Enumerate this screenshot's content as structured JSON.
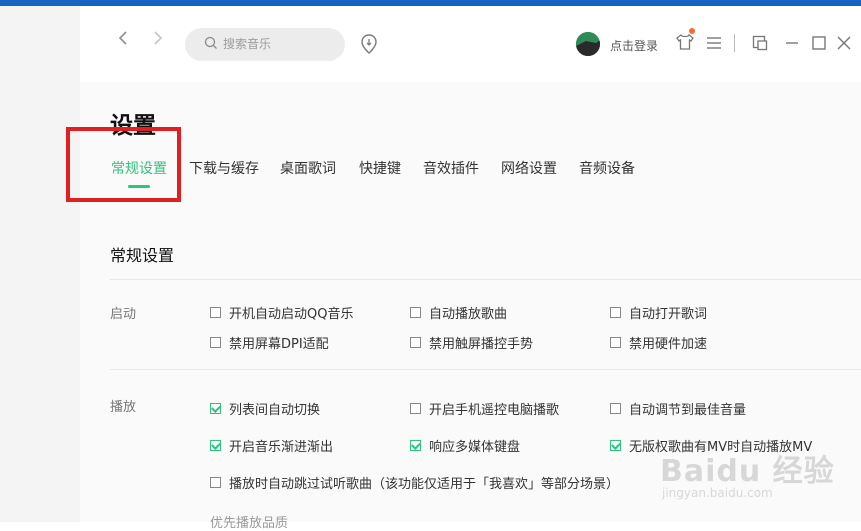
{
  "search": {
    "placeholder": "搜索音乐"
  },
  "header": {
    "login_label": "点击登录"
  },
  "page": {
    "title": "设置"
  },
  "tabs": [
    {
      "label": "常规设置",
      "active": true
    },
    {
      "label": "下载与缓存",
      "active": false
    },
    {
      "label": "桌面歌词",
      "active": false
    },
    {
      "label": "快捷键",
      "active": false
    },
    {
      "label": "音效插件",
      "active": false
    },
    {
      "label": "网络设置",
      "active": false
    },
    {
      "label": "音频设备",
      "active": false
    }
  ],
  "section": {
    "title": "常规设置"
  },
  "groups": [
    {
      "label": "启动",
      "options": [
        {
          "label": "开机自动启动QQ音乐",
          "checked": false
        },
        {
          "label": "自动播放歌曲",
          "checked": false
        },
        {
          "label": "自动打开歌词",
          "checked": false
        },
        {
          "label": "禁用屏幕DPI适配",
          "checked": false
        },
        {
          "label": "禁用触屏播控手势",
          "checked": false
        },
        {
          "label": "禁用硬件加速",
          "checked": false
        }
      ]
    },
    {
      "label": "播放",
      "options": [
        {
          "label": "列表间自动切换",
          "checked": true
        },
        {
          "label": "开启手机遥控电脑播歌",
          "checked": false
        },
        {
          "label": "自动调节到最佳音量",
          "checked": false
        },
        {
          "label": "开启音乐渐进渐出",
          "checked": true
        },
        {
          "label": "响应多媒体键盘",
          "checked": true
        },
        {
          "label": "无版权歌曲有MV时自动播放MV",
          "checked": true
        },
        {
          "label": "播放时自动跳过试听歌曲（该功能仅适用于「我喜欢」等部分场景）",
          "checked": false
        }
      ]
    }
  ],
  "partial_label": "优先播放品质",
  "watermark": {
    "logo": "Baidu 经验",
    "url": "jingyan.baidu.com"
  },
  "colors": {
    "accent": "#31c27c",
    "highlight_box": "#e02020",
    "top_strip": "#1565c0"
  }
}
